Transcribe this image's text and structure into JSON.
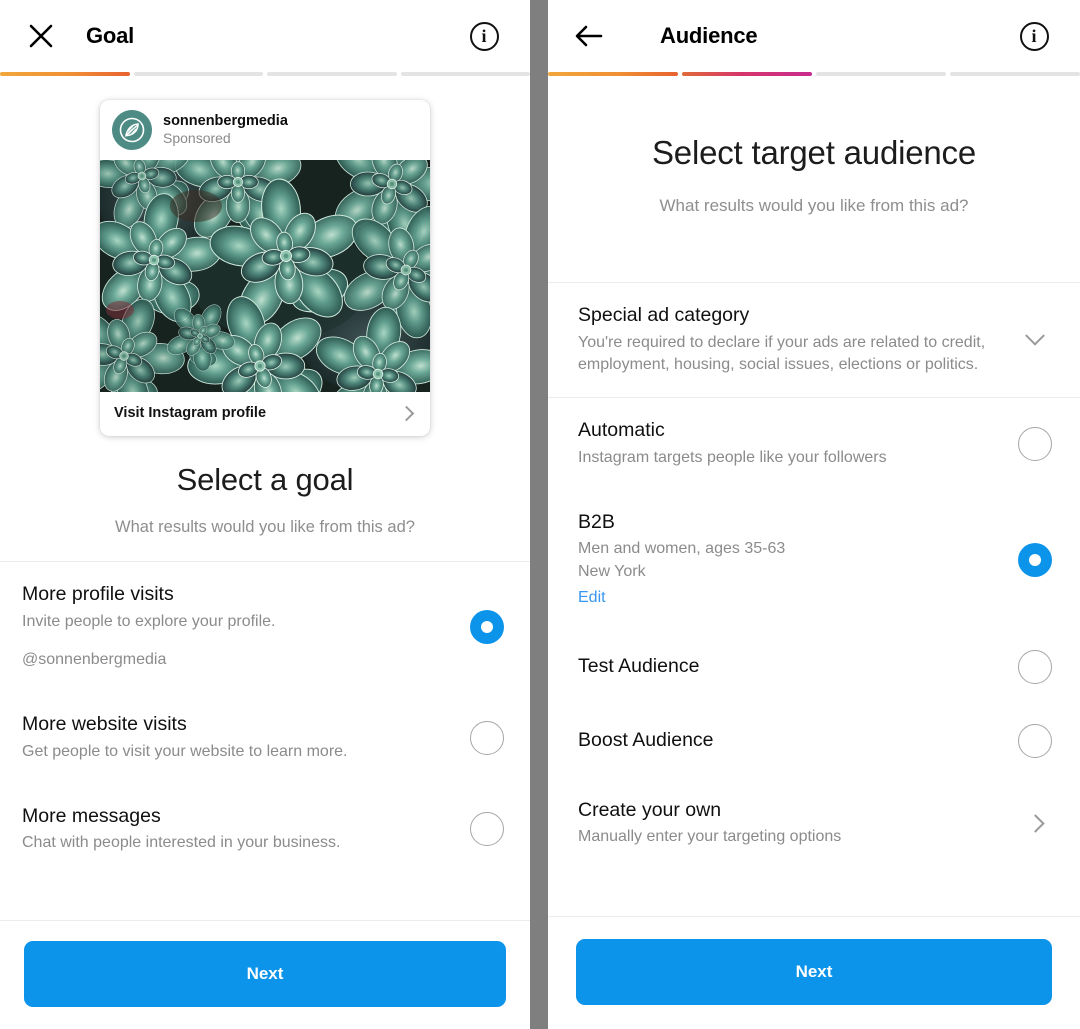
{
  "goal_screen": {
    "header": {
      "close_icon": "close-icon",
      "title": "Goal",
      "info_icon": "info-icon"
    },
    "progress": {
      "steps": 4,
      "filled": 1
    },
    "ad_preview": {
      "username": "sonnenbergmedia",
      "sponsored_label": "Sponsored",
      "avatar_icon": "leaf-logo-icon",
      "image_alt": "succulent-plants-photo",
      "cta_label": "Visit Instagram profile",
      "cta_chevron_icon": "chevron-right-icon"
    },
    "heading": "Select a goal",
    "subheading": "What results would you like from this ad?",
    "options": [
      {
        "title": "More profile visits",
        "desc": "Invite people to explore your profile.",
        "extra": "@sonnenbergmedia",
        "selected": true
      },
      {
        "title": "More website visits",
        "desc": "Get people to visit your website to learn more.",
        "selected": false
      },
      {
        "title": "More messages",
        "desc": "Chat with people interested in your business.",
        "selected": false
      }
    ],
    "next_label": "Next"
  },
  "audience_screen": {
    "header": {
      "back_icon": "arrow-left-icon",
      "title": "Audience",
      "info_icon": "info-icon"
    },
    "progress": {
      "steps": 4,
      "filled": 2
    },
    "heading": "Select target audience",
    "subheading": "What results would you like from this ad?",
    "special_category": {
      "title": "Special ad category",
      "desc": "You're required to declare if your ads are related to credit, employment, housing, social issues, elections or politics.",
      "chevron_icon": "chevron-down-icon"
    },
    "options": [
      {
        "title": "Automatic",
        "desc": "Instagram targets people like your followers",
        "selected": false
      },
      {
        "title": "B2B",
        "desc": "Men and women, ages 35-63",
        "desc2": "New York",
        "link": "Edit",
        "selected": true
      },
      {
        "title": "Test Audience",
        "desc": "",
        "selected": false
      },
      {
        "title": "Boost Audience",
        "desc": "",
        "selected": false
      }
    ],
    "create_own": {
      "title": "Create your own",
      "desc": "Manually enter your targeting options",
      "chevron_icon": "chevron-right-icon"
    },
    "next_label": "Next"
  },
  "colors": {
    "accent_blue": "#0c93ea",
    "link_blue": "#3897f0",
    "progress_orange": "#ef8f35",
    "progress_pink": "#d6356b",
    "gutter_gray": "#7f7f7f"
  }
}
